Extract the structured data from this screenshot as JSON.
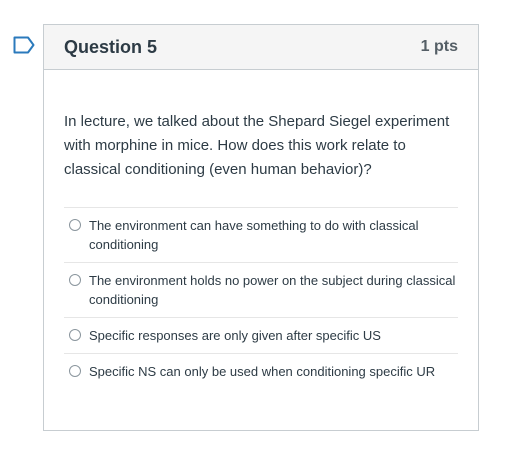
{
  "question": {
    "title": "Question 5",
    "points": "1 pts",
    "prompt": "In lecture, we talked about the Shepard Siegel experiment with morphine in mice. How does this work relate to classical conditioning (even human behavior)?",
    "answers": [
      {
        "label": "The environment can have something to do with classical conditioning",
        "selected": false
      },
      {
        "label": "The environment holds no power on the subject during classical conditioning",
        "selected": false
      },
      {
        "label": "Specific responses are only given after specific US",
        "selected": false
      },
      {
        "label": "Specific NS can only be used when conditioning specific UR",
        "selected": false
      }
    ]
  },
  "icons": {
    "flag": "flag-icon"
  },
  "colors": {
    "flag": "#2b7abc",
    "header_bg": "#f5f5f5",
    "border": "#c7cdd1",
    "text": "#2d3b45"
  }
}
